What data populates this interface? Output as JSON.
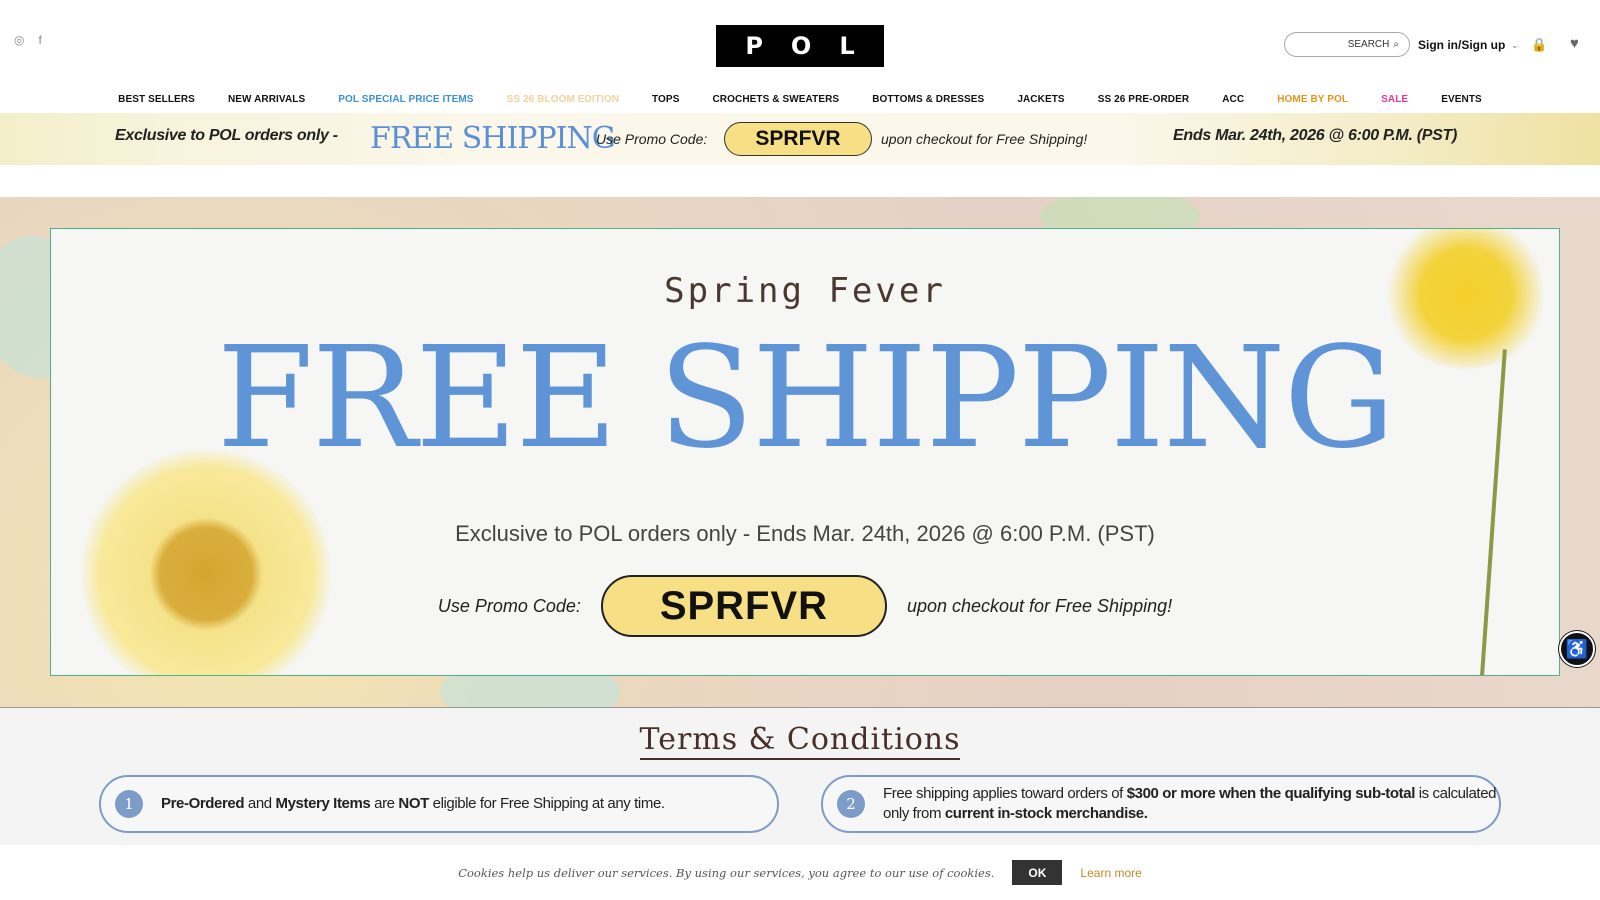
{
  "header": {
    "social": {
      "instagram": "◎",
      "facebook": "f"
    },
    "logo": "POL",
    "search_label": "SEARCH",
    "search_icon": "⌕",
    "signin_label": "Sign in/Sign up",
    "signin_chev": "⌄",
    "bag_icon": "🔒",
    "heart_icon": "♥"
  },
  "nav": {
    "items": [
      {
        "label": "BEST SELLERS",
        "color": "#111111"
      },
      {
        "label": "NEW ARRIVALS",
        "color": "#111111"
      },
      {
        "label": "POL SPECIAL PRICE ITEMS",
        "color": "#3a8fd9"
      },
      {
        "label": "SS 26 BLOOM EDITION",
        "color": "#f0d2a0"
      },
      {
        "label": "TOPS",
        "color": "#111111"
      },
      {
        "label": "CROCHETS & SWEATERS",
        "color": "#111111"
      },
      {
        "label": "BOTTOMS & DRESSES",
        "color": "#111111"
      },
      {
        "label": "JACKETS",
        "color": "#111111"
      },
      {
        "label": "SS 26 PRE-ORDER",
        "color": "#111111"
      },
      {
        "label": "ACC",
        "color": "#111111"
      },
      {
        "label": "HOME BY POL",
        "color": "#e0961c"
      },
      {
        "label": "SALE",
        "color": "#e0399a"
      },
      {
        "label": "EVENTS",
        "color": "#111111"
      }
    ]
  },
  "strip": {
    "exclusive": "Exclusive to POL orders only  -",
    "free_shipping": "FREE SHIPPING",
    "use_code": "Use Promo Code:",
    "code": "SPRFVR",
    "upon": "upon checkout for Free Shipping!",
    "ends": "Ends Mar. 24th, 2026 @ 6:00 P.M. (PST)"
  },
  "hero": {
    "spring": "Spring Fever",
    "title": "FREE SHIPPING",
    "exclusive": "Exclusive to POL orders only - Ends Mar. 24th, 2026 @ 6:00 P.M. (PST)",
    "use_code": "Use Promo Code:",
    "code": "SPRFVR",
    "upon": "upon checkout for Free Shipping!",
    "accessibility_icon": "♿"
  },
  "terms": {
    "title": "Terms & Conditions",
    "items": [
      {
        "num": "1",
        "parts": [
          [
            "b",
            "Pre-Ordered"
          ],
          [
            "t",
            " and "
          ],
          [
            "b",
            "Mystery Items"
          ],
          [
            "t",
            " are "
          ],
          [
            "b",
            "NOT"
          ],
          [
            "t",
            " eligible for Free Shipping at any time."
          ]
        ]
      },
      {
        "num": "2",
        "parts": [
          [
            "t",
            "Free shipping applies toward orders of "
          ],
          [
            "b",
            "$300 or more when the qualifying sub-total"
          ],
          [
            "t",
            " is calculated only from "
          ],
          [
            "b",
            "current in-stock merchandise."
          ]
        ]
      }
    ]
  },
  "cookie": {
    "message": "Cookies help us deliver our services. By using our services, you agree to our use of cookies.",
    "ok": "OK",
    "learn_more": "Learn more"
  }
}
